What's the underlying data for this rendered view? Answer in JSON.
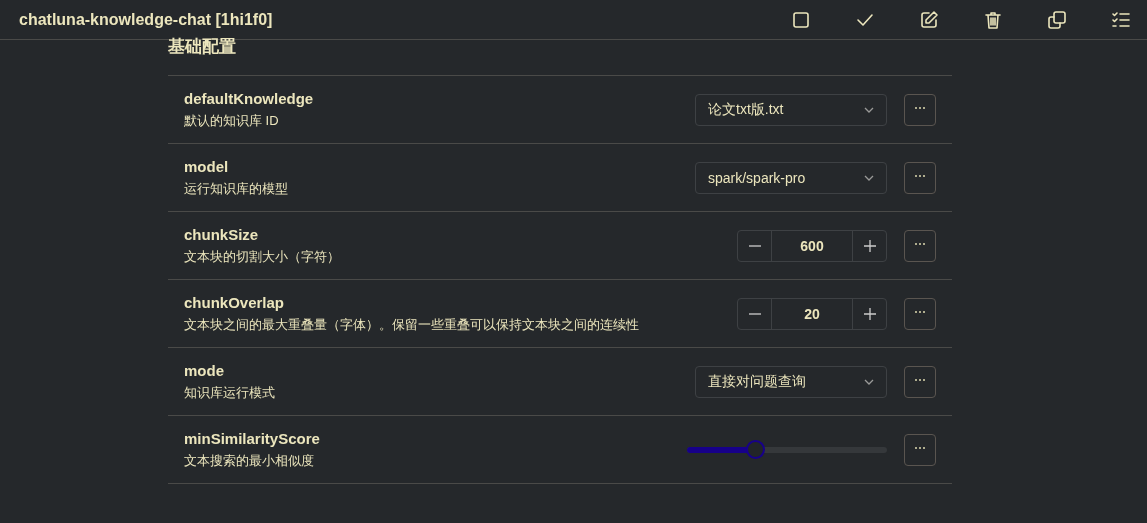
{
  "window": {
    "title": "chatluna-knowledge-chat [1hi1f0]"
  },
  "section": {
    "title": "基础配置"
  },
  "rows": [
    {
      "kind": "select",
      "name": "defaultKnowledge",
      "description": "默认的知识库 ID",
      "value": "论文txt版.txt"
    },
    {
      "kind": "select",
      "name": "model",
      "description": "运行知识库的模型",
      "value": "spark/spark-pro"
    },
    {
      "kind": "number",
      "name": "chunkSize",
      "description": "文本块的切割大小（字符）",
      "value": "600"
    },
    {
      "kind": "number",
      "name": "chunkOverlap",
      "description": "文本块之间的最大重叠量（字体）。保留一些重叠可以保持文本块之间的连续性",
      "value": "20"
    },
    {
      "kind": "select",
      "name": "mode",
      "description": "知识库运行模式",
      "value": "直接对问题查询"
    },
    {
      "kind": "slider",
      "name": "minSimilarityScore",
      "description": "文本搜索的最小相似度",
      "level": 0.34
    }
  ]
}
